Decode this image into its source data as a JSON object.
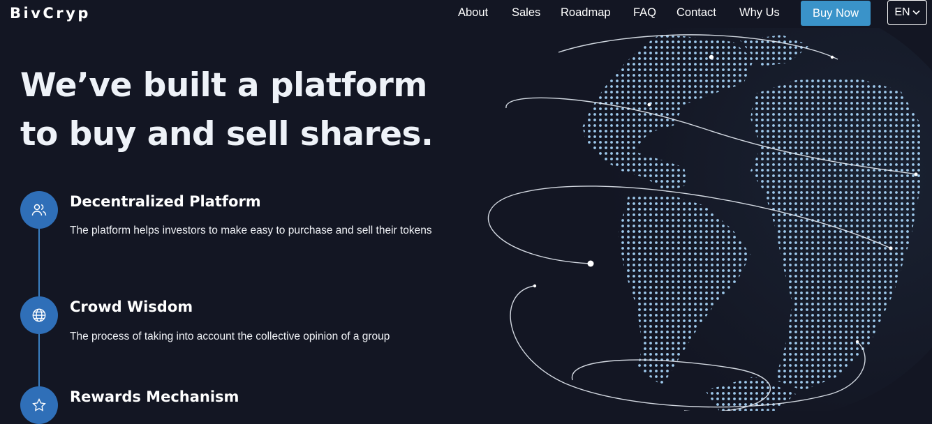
{
  "brand": "BivCryp",
  "nav": {
    "items": [
      "About",
      "Sales",
      "Roadmap",
      "FAQ",
      "Contact",
      "Why Us"
    ],
    "cta": "Buy Now",
    "language": "EN"
  },
  "hero": {
    "line1": "We’ve built a platform",
    "line2": "to buy and sell shares."
  },
  "features": [
    {
      "title": "Decentralized Platform",
      "desc": "The platform helps investors to make easy to purchase and sell their tokens",
      "icon": "users-icon"
    },
    {
      "title": "Crowd Wisdom",
      "desc": "The process of taking into account the collective opinion of a group",
      "icon": "globe-icon"
    },
    {
      "title": "Rewards Mechanism",
      "desc": "",
      "icon": "star-icon"
    }
  ],
  "colors": {
    "background": "#131623",
    "accent": "#3a93c9",
    "icon_circle": "#2f6fb8"
  }
}
